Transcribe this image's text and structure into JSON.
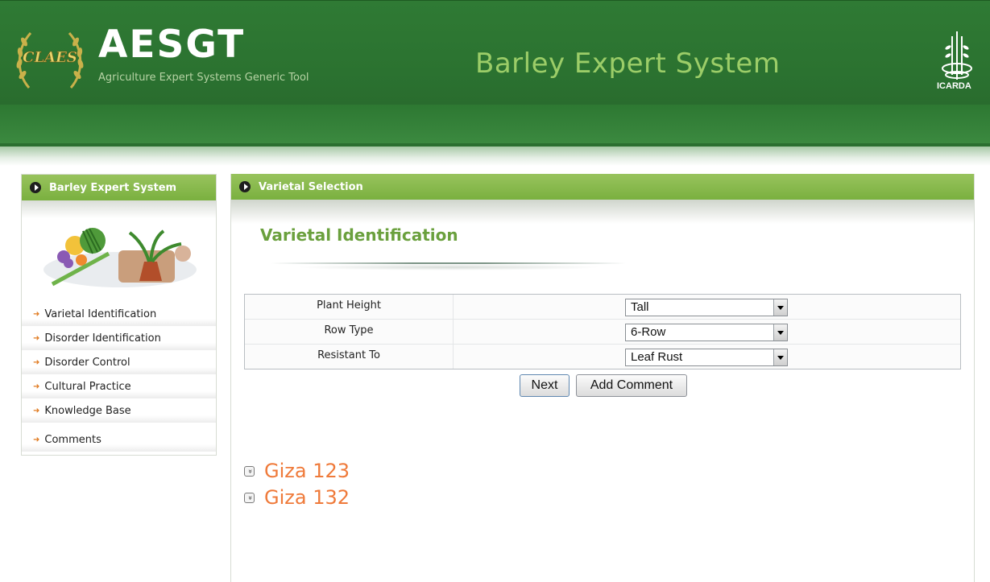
{
  "header": {
    "brand_title": "AESGT",
    "brand_subtitle": "Agriculture Expert Systems Generic Tool",
    "system_title": "Barley Expert System",
    "left_logo_text": "CLAES",
    "right_logo_text": "ICARDA"
  },
  "sidebar": {
    "title": "Barley Expert System",
    "items": [
      {
        "label": "Varietal Identification"
      },
      {
        "label": "Disorder Identification"
      },
      {
        "label": "Disorder Control"
      },
      {
        "label": "Cultural Practice"
      },
      {
        "label": "Knowledge Base"
      },
      {
        "label": "Comments"
      }
    ]
  },
  "main": {
    "panel_title": "Varietal Selection",
    "section_title": "Varietal Identification",
    "form": {
      "rows": [
        {
          "label": "Plant Height",
          "value": "Tall"
        },
        {
          "label": "Row Type",
          "value": "6-Row"
        },
        {
          "label": "Resistant To",
          "value": "Leaf Rust"
        }
      ]
    },
    "buttons": {
      "next": "Next",
      "add_comment": "Add Comment"
    },
    "results": [
      {
        "label": "Giza 123"
      },
      {
        "label": "Giza 132"
      }
    ]
  },
  "colors": {
    "header_green": "#2f7a34",
    "panel_header": "#7ab03f",
    "system_title": "#9ccd68",
    "section_title": "#6aa03d",
    "result_text": "#ef7a3a",
    "bullet": "#e07a1f"
  },
  "icons": {
    "panel_arrow": "circle-arrow-right-icon",
    "nav_bullet": "arrow-bullet-icon",
    "expand": "double-chevron-down-icon",
    "dropdown": "dropdown-arrow-icon"
  }
}
